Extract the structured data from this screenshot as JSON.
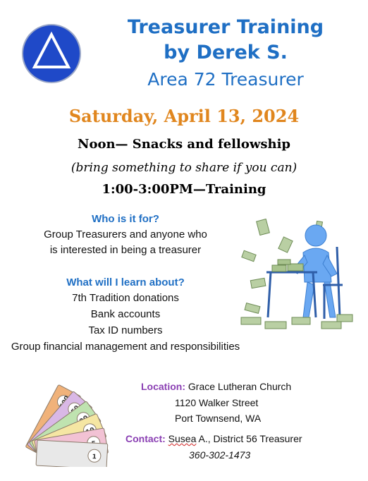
{
  "header": {
    "title_line1": "Treasurer Training",
    "title_line2": "by Derek S.",
    "subtitle": "Area 72 Treasurer"
  },
  "event": {
    "date": "Saturday, April 13, 2024",
    "noon_line": "Noon— Snacks and fellowship",
    "bring_line": "(bring something to share if you can)",
    "training_line": "1:00-3:00PM—Training"
  },
  "who": {
    "heading": "Who is it for?",
    "line1": "Group Treasurers and anyone who",
    "line2": "is interested in being a treasurer"
  },
  "learn": {
    "heading": "What will I learn about?",
    "items": [
      "7th Tradition donations",
      "Bank accounts",
      "Tax ID numbers",
      "Group financial management and responsibilities"
    ]
  },
  "location": {
    "label": "Location:",
    "name": "Grace Lutheran Church",
    "street": "1120 Walker Street",
    "city": "Port Townsend, WA"
  },
  "contact": {
    "label": "Contact:",
    "name_first": "Susea",
    "name_rest": " A., District 56 Treasurer",
    "phone": "360-302-1473"
  },
  "bill_labels": [
    "500",
    "50",
    "20",
    "10",
    "5",
    "1"
  ],
  "colors": {
    "title_blue": "#1f6fc4",
    "date_orange": "#e0861e",
    "label_purple": "#8a3fb3",
    "logo_blue": "#1f49c8"
  },
  "icons": {
    "logo": "triangle-in-circle-logo",
    "figure": "person-counting-money-icon",
    "bills": "play-money-fan-icon"
  }
}
